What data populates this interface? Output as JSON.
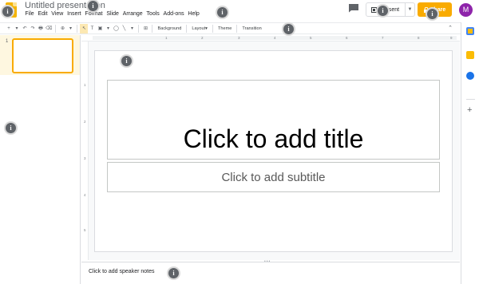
{
  "header": {
    "doc_title": "Untitled presentation",
    "menu": [
      "File",
      "Edit",
      "View",
      "Insert",
      "Format",
      "Slide",
      "Arrange",
      "Tools",
      "Add-ons",
      "Help"
    ],
    "present_label": "Present",
    "share_label": "Share",
    "avatar_letter": "M",
    "accent_color": "#f9ab00",
    "avatar_color": "#8e24aa"
  },
  "toolbar": {
    "new_slide": "+",
    "caret": "▾",
    "undo": "↶",
    "redo": "↷",
    "print": "🖶",
    "paint": "⌫",
    "zoom": "⊕",
    "select": "↖",
    "textbox": "T",
    "image": "▣",
    "shape": "◯",
    "line": "╲",
    "comment": "⊞",
    "background_label": "Background",
    "layout_label": "Layout",
    "theme_label": "Theme",
    "transition_label": "Transition",
    "collapse": "⌃"
  },
  "filmstrip": {
    "slide_number": "1"
  },
  "rulers": {
    "top": [
      "1",
      "2",
      "3",
      "4",
      "5",
      "6",
      "7",
      "8",
      "9"
    ],
    "left": [
      "1",
      "2",
      "3",
      "4",
      "5"
    ]
  },
  "slide": {
    "title_placeholder": "Click to add title",
    "subtitle_placeholder": "Click to add subtitle"
  },
  "notes": {
    "placeholder": "Click to add speaker notes"
  },
  "sidepanel": {
    "icons": [
      "calendar-icon",
      "keep-icon",
      "tasks-icon"
    ],
    "add_label": "+"
  },
  "overlay_marker": "i"
}
